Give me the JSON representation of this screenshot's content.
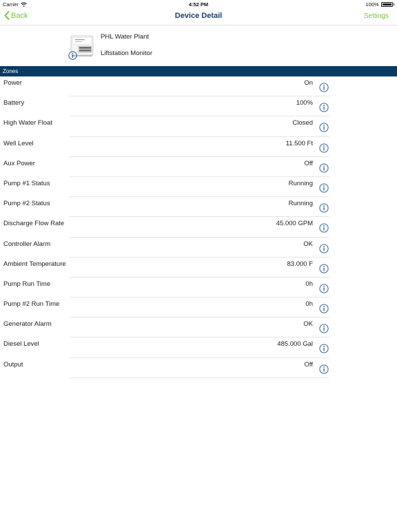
{
  "status_bar": {
    "carrier": "Carrier",
    "time": "4:52 PM",
    "battery": "100%",
    "battery_level": 1.0
  },
  "nav": {
    "back_label": "Back",
    "title": "Device Detail",
    "settings_label": "Settings"
  },
  "device": {
    "name": "PHL Water Plant",
    "type": "Liftstation Monitor"
  },
  "zones_header": "Zones",
  "zones": [
    {
      "label": "Power",
      "value": "On"
    },
    {
      "label": "Battery",
      "value": "100%"
    },
    {
      "label": "High Water Float",
      "value": "Closed"
    },
    {
      "label": "Well Level",
      "value": "11.500 Ft"
    },
    {
      "label": "Aux Power",
      "value": "Off"
    },
    {
      "label": "Pump #1 Status",
      "value": "Running"
    },
    {
      "label": "Pump #2 Status",
      "value": "Running"
    },
    {
      "label": "Discharge Flow Rate",
      "value": "45.000 GPM"
    },
    {
      "label": "Controller Alarm",
      "value": "OK"
    },
    {
      "label": "Ambient Temperature",
      "value": "83.000 F"
    },
    {
      "label": "Pump Run Time",
      "value": "0h"
    },
    {
      "label": "Pump #2 Run Time",
      "value": "0h"
    },
    {
      "label": "Generator Alarm",
      "value": "OK"
    },
    {
      "label": "Diesel Level",
      "value": "485.000 Gal"
    },
    {
      "label": "Output",
      "value": "Off"
    }
  ],
  "colors": {
    "accent": "#7cbf44",
    "nav_title": "#1b3f6a",
    "zones_header_bg": "#083a63",
    "info_icon": "#1b4f8a"
  },
  "icons": {
    "back": "chevron-left-icon",
    "info": "info-circle-icon",
    "wifi": "wifi-icon",
    "battery": "battery-icon",
    "device": "device-image"
  }
}
